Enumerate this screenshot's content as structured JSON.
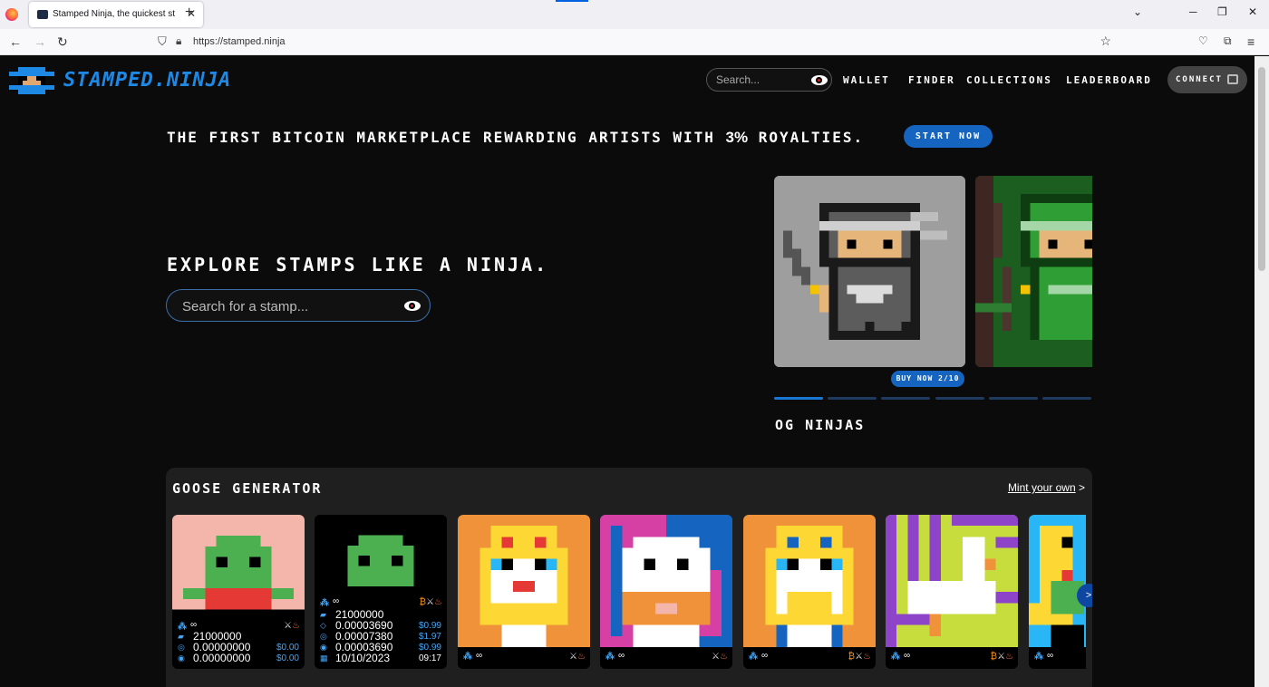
{
  "browser": {
    "tab_title": "Stamped Ninja, the quickest st",
    "tab_close": "✕",
    "new_tab": "+",
    "url": "https://stamped.ninja",
    "win_minimize": "─",
    "win_restore": "❐",
    "win_close": "✕",
    "tab_list": "⌄"
  },
  "header": {
    "brand": "STAMPED.NINJA",
    "search_placeholder": "Search...",
    "nav": [
      "WALLET",
      "FINDER",
      "COLLECTIONS",
      "LEADERBOARD"
    ],
    "connect": "CONNECT"
  },
  "hero": {
    "tagline_pre": "THE FIRST BITCOIN MARKETPLACE REWARDING ARTISTS WITH ",
    "tagline_bold": "3%",
    "tagline_post": " ROYALTIES.",
    "start_now": "START NOW",
    "headline": "EXPLORE STAMPS LIKE A NINJA.",
    "search_placeholder": "Search for a stamp...",
    "buy_now": "BUY NOW",
    "slide_counter": "2/10",
    "collection_name": "OG NINJAS",
    "slides_total": 10,
    "slide_active": 1
  },
  "goose": {
    "title": "GOOSE GENERATOR",
    "mint_link": "Mint your own",
    "mint_arrow": ">",
    "next": ">",
    "cards": [
      {
        "supply": "∞",
        "stats": [
          {
            "value": "21000000",
            "usd": ""
          },
          {
            "value": "0.00000000",
            "usd": "$0.00"
          },
          {
            "value": "0.00000000",
            "usd": "$0.00"
          }
        ]
      },
      {
        "supply": "∞",
        "stats": [
          {
            "value": "21000000",
            "usd": ""
          },
          {
            "value": "0.00003690",
            "usd": "$0.99"
          },
          {
            "value": "0.00007380",
            "usd": "$1.97"
          },
          {
            "value": "0.00003690",
            "usd": "$0.99"
          },
          {
            "value": "10/10/2023",
            "usd": "09:17"
          }
        ]
      },
      {
        "supply": "∞"
      },
      {
        "supply": "∞"
      },
      {
        "supply": "∞"
      },
      {
        "supply": "∞"
      },
      {
        "supply": "∞"
      }
    ]
  },
  "colors": {
    "accent": "#1e88e5",
    "button": "#1565c0",
    "background": "#0b0b0b",
    "panel": "#1f1f1f"
  }
}
